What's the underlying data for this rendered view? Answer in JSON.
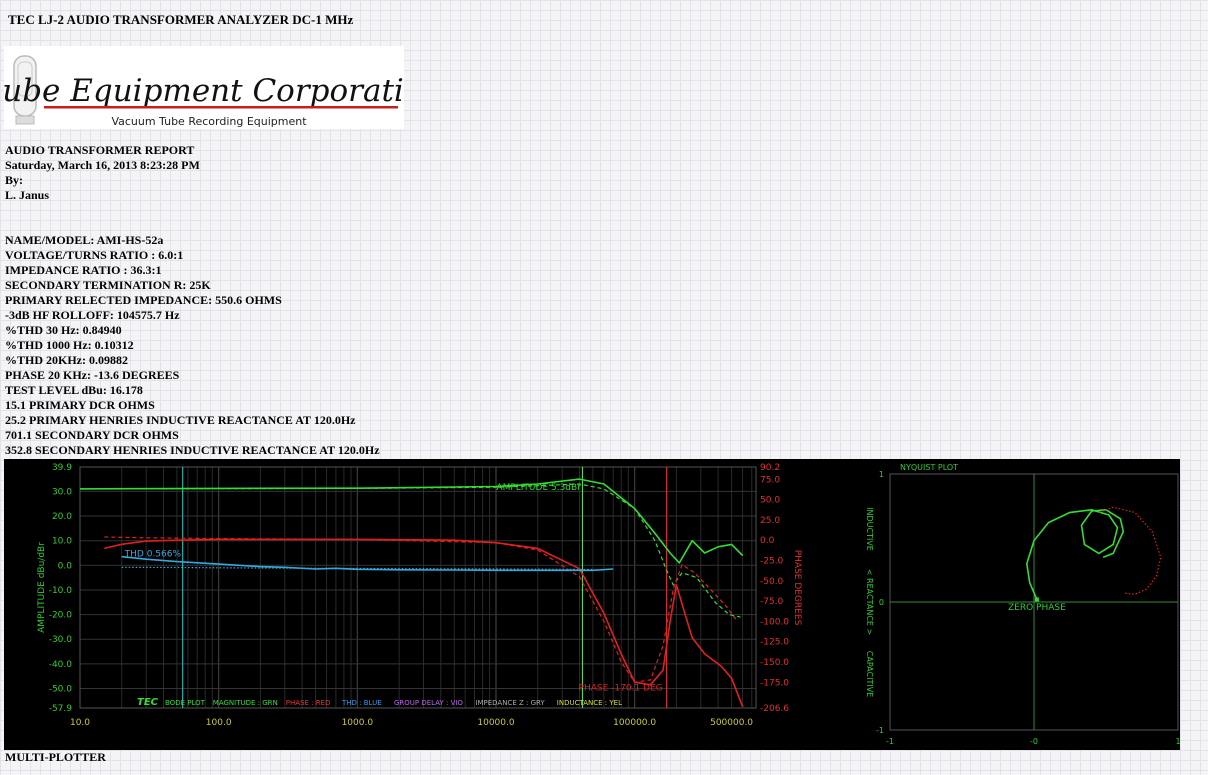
{
  "page_title": "TEC LJ-2 AUDIO TRANSFORMER ANALYZER DC-1 MHz",
  "logo": {
    "name": "Tube Equipment Corporation",
    "tagline": "Vacuum Tube Recording Equipment"
  },
  "report": {
    "heading": "AUDIO TRANSFORMER REPORT",
    "datetime": "Saturday, March 16, 2013 8:23:28 PM",
    "by_label": "By:",
    "author": "L. Janus"
  },
  "specs": [
    "NAME/MODEL: AMI-HS-52a",
    "VOLTAGE/TURNS RATIO : 6.0:1",
    "IMPEDANCE RATIO : 36.3:1",
    "SECONDARY TERMINATION R: 25K",
    "PRIMARY RELECTED IMPEDANCE: 550.6 OHMS",
    "-3dB HF ROLLOFF: 104575.7 Hz",
    "%THD 30 Hz: 0.84940",
    "%THD 1000 Hz: 0.10312",
    "%THD 20KHz: 0.09882",
    "PHASE 20 KHz: -13.6 DEGREES",
    "TEST LEVEL dBu: 16.178",
    "15.1 PRIMARY DCR OHMS",
    "25.2 PRIMARY HENRIES INDUCTIVE REACTANCE AT 120.0Hz",
    "701.1 SECONDARY DCR OHMS",
    "352.8 SECONDARY HENRIES INDUCTIVE REACTANCE AT 120.0Hz"
  ],
  "footer_label": "MULTI-PLOTTER",
  "colors": {
    "magnitude": "#33dd33",
    "phase": "#e02020",
    "thd": "#33aadd",
    "grid": "#3a3a3a",
    "left_axis_text": "#33cc33",
    "right_axis_text": "#e03030",
    "x_axis_text": "#cccc33",
    "cursor_cyan": "#33cccc",
    "cursor_green": "#66ee66",
    "cursor_red": "#ee3333"
  },
  "chart_data": [
    {
      "type": "line",
      "xscale": "log",
      "xlim": [
        10,
        750000
      ],
      "ylim": [
        -57.9,
        39.9
      ],
      "y2lim": [
        -206.6,
        90.2
      ],
      "ylabel": "AMPLITUDE dBu/dBr",
      "y2label": "PHASE DEGREES",
      "x_ticks": [
        10,
        100,
        1000,
        10000,
        100000,
        500000
      ],
      "x_tick_labels": [
        "10.0",
        "100.0",
        "1000.0",
        "10000.0",
        "100000.0",
        "500000.0"
      ],
      "y_ticks": [
        39.9,
        30,
        20,
        10,
        0,
        -10,
        -20,
        -30,
        -40,
        -50,
        -57.9
      ],
      "y_tick_labels": [
        "39.9",
        "30.0",
        "20.0",
        "10.0",
        "0.0",
        "-10.0",
        "-20.0",
        "-30.0",
        "-40.0",
        "-50.0",
        "-57.9"
      ],
      "y2_ticks": [
        90.2,
        75,
        50,
        25,
        0,
        -25,
        -50,
        -75,
        -100,
        -125,
        -150,
        -175,
        -206.6
      ],
      "y2_tick_labels": [
        "90.2",
        "75.0",
        "50.0",
        "25.0",
        "0.0",
        "-25.0",
        "-50.0",
        "-75.0",
        "-100.0",
        "-125.0",
        "-150.0",
        "-175.0",
        "-206.6"
      ],
      "grid": true,
      "annotations": {
        "amplitude": "AMPLITUDE 5.3dBr",
        "thd": "THD 0.566%",
        "phase": "PHASE -170.1 DEG"
      },
      "legend": {
        "brand": "TEC",
        "items": [
          {
            "text": "BODE PLOT",
            "color": "#33dd33"
          },
          {
            "text": "MAGNITUDE : GRN",
            "color": "#33dd33"
          },
          {
            "text": "PHASE : RED",
            "color": "#ee3333"
          },
          {
            "text": "THD : BLUE",
            "color": "#3399ee"
          },
          {
            "text": "GROUP DELAY : VIO",
            "color": "#bb66ee"
          },
          {
            "text": "IMPEDANCE Z : GRY",
            "color": "#aaaaaa"
          },
          {
            "text": "INDUCTANCE : YEL",
            "color": "#dddd33"
          }
        ]
      },
      "cursors": [
        {
          "x": 55,
          "color": "#33cccc"
        },
        {
          "x": 42000,
          "color": "#66ee66"
        },
        {
          "x": 170000,
          "color": "#ee3333"
        }
      ],
      "series": [
        {
          "name": "MAGNITUDE",
          "axis": "left",
          "style": "solid",
          "x": [
            10,
            100,
            1000,
            10000,
            20000,
            40000,
            60000,
            100000,
            140000,
            180000,
            210000,
            260000,
            320000,
            400000,
            500000,
            600000
          ],
          "y": [
            31.0,
            31.2,
            31.3,
            32.0,
            33.0,
            35.0,
            33.0,
            23.0,
            13.0,
            5.0,
            1.0,
            10.0,
            5.0,
            7.5,
            8.5,
            4.0
          ]
        },
        {
          "name": "MAGNITUDE REF",
          "axis": "left",
          "style": "dashed",
          "x": [
            10,
            100,
            1000,
            10000,
            20000,
            40000,
            60000,
            100000,
            140000,
            170000,
            190000,
            220000,
            280000,
            380000,
            480000,
            580000
          ],
          "y": [
            31.0,
            31.1,
            31.2,
            31.7,
            32.3,
            33.0,
            31.0,
            23.0,
            10.0,
            -2.0,
            -8.0,
            -3.0,
            -5.0,
            -15.0,
            -20.0,
            -21.0
          ]
        },
        {
          "name": "PHASE",
          "axis": "right",
          "style": "solid",
          "x": [
            15,
            20,
            30,
            50,
            100,
            1000,
            5000,
            10000,
            20000,
            40000,
            60000,
            80000,
            100000,
            130000,
            160000,
            180000,
            200000,
            230000,
            260000,
            320000,
            420000,
            500000,
            600000
          ],
          "y": [
            -10,
            -5,
            -1,
            0,
            1,
            1,
            0,
            -3,
            -10,
            -35,
            -90,
            -140,
            -175,
            -178,
            -160,
            -100,
            -55,
            -90,
            -120,
            -140,
            -155,
            -170,
            -205
          ]
        },
        {
          "name": "PHASE REF",
          "axis": "right",
          "style": "dashed",
          "x": [
            15,
            30,
            100,
            1000,
            10000,
            20000,
            40000,
            60000,
            80000,
            100000,
            130000,
            160000,
            190000,
            220000,
            270000,
            350000,
            450000,
            550000
          ],
          "y": [
            4,
            3,
            2,
            1,
            -3,
            -12,
            -45,
            -100,
            -150,
            -175,
            -172,
            -130,
            -60,
            -30,
            -40,
            -60,
            -80,
            -100
          ]
        },
        {
          "name": "THD",
          "axis": "left",
          "style": "solid",
          "x": [
            20,
            30,
            50,
            100,
            200,
            300,
            500,
            700,
            1000,
            2000,
            5000,
            10000,
            20000,
            50000,
            70000
          ],
          "y": [
            3.5,
            2.5,
            1.5,
            0.5,
            -0.5,
            -0.8,
            -1.5,
            -1.2,
            -1.6,
            -1.8,
            -1.9,
            -2.0,
            -2.0,
            -2.0,
            -1.5
          ]
        },
        {
          "name": "THD REF",
          "axis": "left",
          "style": "dotted",
          "x": [
            20,
            50,
            100,
            1000,
            10000,
            50000
          ],
          "y": [
            -0.8,
            -0.9,
            -1.0,
            -1.3,
            -1.5,
            -1.7
          ]
        }
      ]
    },
    {
      "type": "line",
      "title": "NYQUIST PLOT",
      "ylabel_top": "INDUCTIVE",
      "ylabel_mid": "< REACTANCE >",
      "ylabel_bot": "CAPACITIVE",
      "xlim": [
        -1,
        1
      ],
      "ylim": [
        -1,
        1
      ],
      "x_ticks": [
        -1,
        0,
        1
      ],
      "x_tick_labels": [
        "-1",
        "-0",
        "1"
      ],
      "y_ticks": [
        1,
        0,
        -1
      ],
      "y_tick_labels": [
        "1",
        "0",
        "-1"
      ],
      "annotation": "ZERO PHASE",
      "series": [
        {
          "name": "NYQUIST",
          "style": "solid",
          "x": [
            0.02,
            -0.03,
            -0.05,
            0.0,
            0.1,
            0.25,
            0.4,
            0.52,
            0.58,
            0.55,
            0.45,
            0.35,
            0.33,
            0.4,
            0.5,
            0.6,
            0.62,
            0.55,
            0.48
          ],
          "y": [
            0.02,
            0.15,
            0.3,
            0.48,
            0.62,
            0.7,
            0.72,
            0.68,
            0.58,
            0.45,
            0.38,
            0.45,
            0.6,
            0.71,
            0.72,
            0.65,
            0.55,
            0.38,
            0.35
          ]
        },
        {
          "name": "NYQUIST REF",
          "style": "dotted",
          "x": [
            0.45,
            0.55,
            0.7,
            0.82,
            0.88,
            0.85,
            0.78,
            0.7,
            0.62
          ],
          "y": [
            0.7,
            0.74,
            0.7,
            0.55,
            0.35,
            0.2,
            0.1,
            0.06,
            0.07
          ]
        }
      ]
    }
  ]
}
